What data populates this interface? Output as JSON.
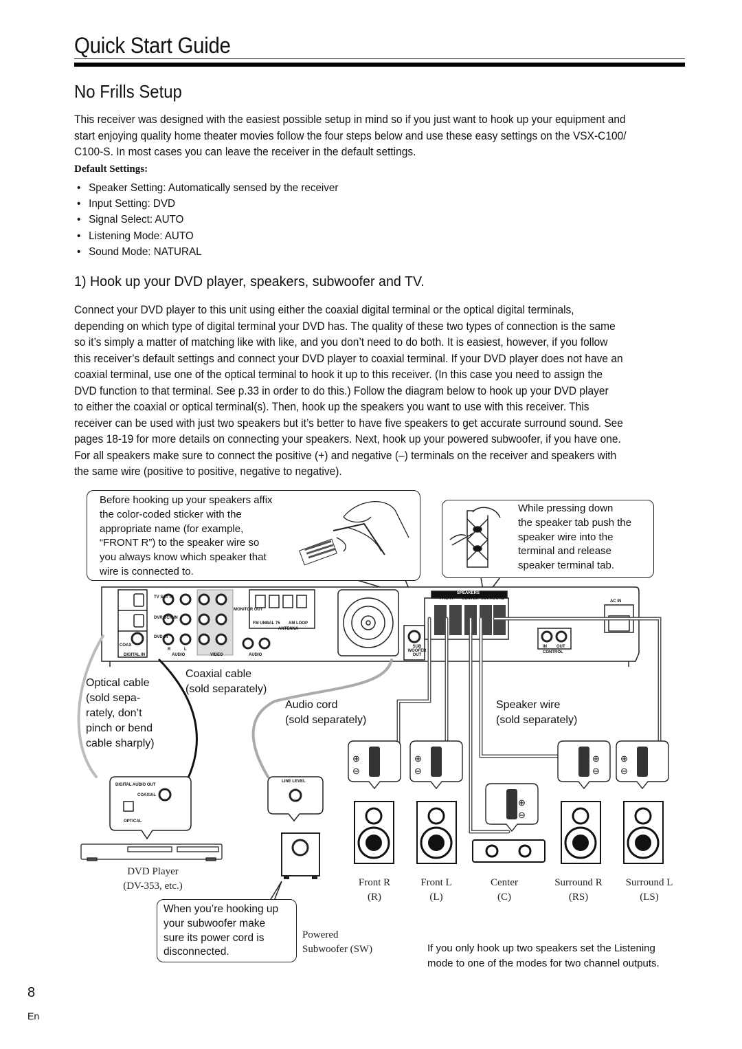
{
  "header": {
    "title": "Quick Start Guide"
  },
  "section": {
    "title": "No Frills Setup",
    "intro_lines": [
      "This receiver was designed with the easiest possible setup in mind so if you just want to hook up your equipment and",
      "start enjoying quality home theater movies follow the four steps below and use these easy settings on the VSX-C100/",
      "C100-S. In most cases you can leave the receiver in the default settings."
    ],
    "defaults_heading": "Default Settings:",
    "defaults": [
      "Speaker Setting: Automatically sensed by the receiver",
      "Input Setting: DVD",
      "Signal Select: AUTO",
      "Listening Mode: AUTO",
      "Sound Mode: NATURAL"
    ],
    "bullet": "•"
  },
  "step1": {
    "title": "1) Hook up your DVD player, speakers, subwoofer and TV.",
    "body_lines": [
      "Connect your DVD player to this unit using either the coaxial digital terminal or the optical digital terminals,",
      "depending on which type of digital terminal your DVD has. The quality of these two types of connection is the same",
      "so it’s simply a matter of matching like with like, and you don’t need to do both. It is easiest, however, if you follow",
      "this receiver’s default settings and connect your DVD player to coaxial terminal. If your DVD player does not have an",
      "coaxial terminal, use one of the optical terminal to hook it up to this receiver. (In this case you need to assign the",
      "DVD function to that terminal. See p.33 in order to do this.) Follow the diagram below to hook up your DVD player",
      "to either the coaxial or optical terminal(s). Then, hook up the speakers you want to use with this receiver. This",
      "receiver can be used with just two speakers but it’s better to have five speakers to get accurate surround sound. See",
      "pages 18-19 for more details on connecting your speakers. Next, hook up your powered subwoofer, if you have one.",
      "For all speakers make sure to connect the positive (+) and negative (–) terminals on the receiver and speakers with",
      "the same wire (positive to positive, negative to negative)."
    ]
  },
  "diagram": {
    "callout_sticker": [
      "Before hooking up your speakers affix",
      "the color-coded sticker with the",
      "appropriate name (for example,",
      "“FRONT R”) to the speaker wire so",
      "you always know which speaker that",
      "wire is connected to."
    ],
    "callout_terminal": [
      "While pressing down",
      "the speaker tab push the",
      "speaker wire into the",
      "terminal and release",
      "speaker terminal tab."
    ],
    "receiver_labels": {
      "digital_in": "DIGITAL IN",
      "audio": "AUDIO",
      "video": "VIDEO",
      "audio2": "AUDIO",
      "antenna": "ANTENNA",
      "fm": "FM UNBAL 75",
      "am": "AM LOOP",
      "monitor_out": "MONITOR OUT",
      "speakers": "SPEAKERS",
      "front": "FRONT",
      "center": "CENTER",
      "surround": "SURROUND",
      "subwoofer_out": "SUB WOOFER OUT",
      "control": "CONTROL",
      "control_in": "IN",
      "control_out": "OUT",
      "ac_in": "AC IN",
      "coax": "COAX",
      "tv_sat_in": "TV SAT IN",
      "dvr_vcr_in": "DVR VCR IN",
      "dvd_in": "DVD IN",
      "r": "R",
      "l": "L"
    },
    "optical_cable": [
      "Optical cable",
      "(sold sepa-",
      "rately, don’t",
      "pinch or bend",
      "cable sharply)"
    ],
    "coaxial_cable": [
      "Coaxial cable",
      "(sold separately)"
    ],
    "audio_cord": [
      "Audio cord",
      "(sold separately)"
    ],
    "speaker_wire": [
      "Speaker wire",
      "(sold separately)"
    ],
    "dvd_panel": {
      "digital_audio_out": "DIGITAL AUDIO OUT",
      "coaxial": "COAXIAL",
      "optical": "OPTICAL"
    },
    "sub_panel": {
      "line_level": "LINE LEVEL"
    },
    "dvd_player": [
      "DVD Player",
      "(DV-353, etc.)"
    ],
    "subwoofer_note": [
      "When you’re hooking up",
      "your subwoofer make",
      "sure its power cord is",
      "disconnected."
    ],
    "subwoofer_label": [
      "Powered",
      "Subwoofer (SW)"
    ],
    "speakers": [
      {
        "name": "Front R",
        "abbr": "(R)"
      },
      {
        "name": "Front  L",
        "abbr": "(L)"
      },
      {
        "name": "Center",
        "abbr": "(C)"
      },
      {
        "name": "Surround  R",
        "abbr": "(RS)"
      },
      {
        "name": "Surround L",
        "abbr": "(LS)"
      }
    ],
    "plus": "⊕",
    "minus": "⊖",
    "two_speaker_note": [
      "If you only hook up two speakers set the Listening",
      "mode to one of the modes for two channel outputs."
    ]
  },
  "footer": {
    "page_number": "8",
    "language": "En"
  }
}
